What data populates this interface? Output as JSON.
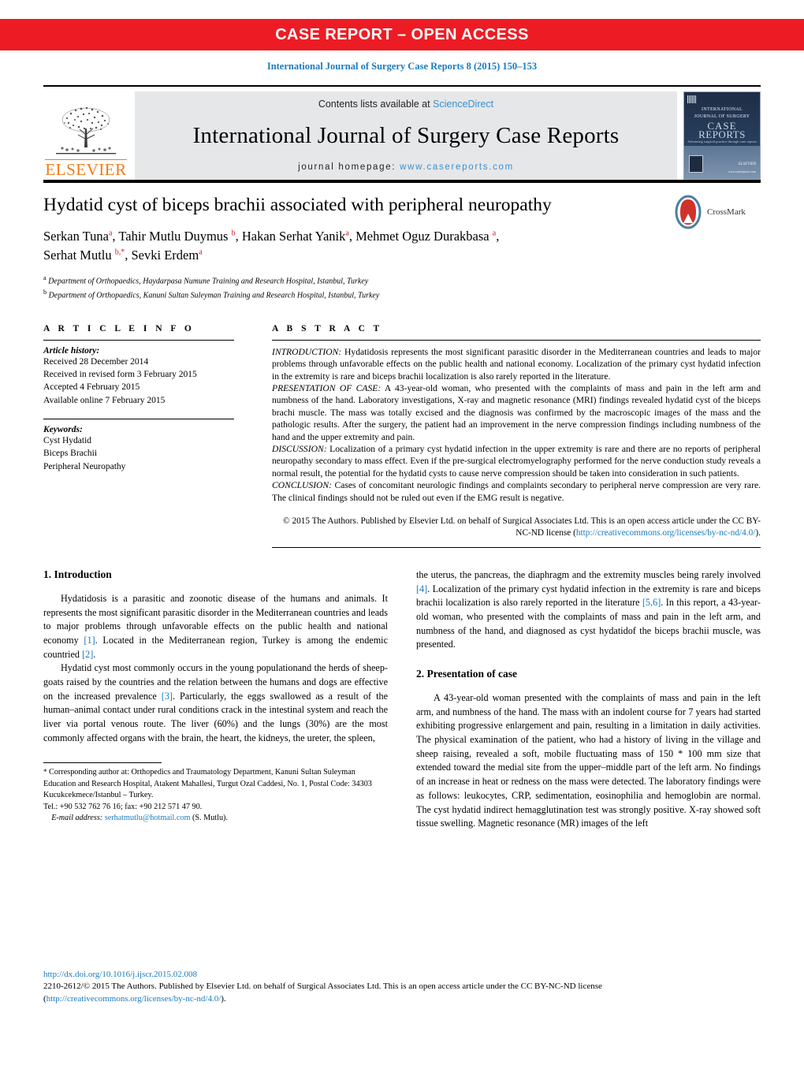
{
  "banner": {
    "text": "CASE REPORT – OPEN ACCESS",
    "color": "#ed1c24"
  },
  "citation": "International Journal of Surgery Case Reports 8 (2015) 150–153",
  "masthead": {
    "contents_prefix": "Contents lists available at ",
    "sciencedirect": "ScienceDirect",
    "journal_title": "International Journal of Surgery Case Reports",
    "homepage_prefix": "journal homepage: ",
    "homepage_url": "www.casereports.com",
    "publisher": "ELSEVIER",
    "cover": {
      "line1": "INTERNATIONAL",
      "line2": "JOURNAL OF SURGERY",
      "line3": "CASE",
      "line4": "REPORTS",
      "tagline": "Advancing surgical practice through case reports",
      "brand": "ELSEVIER",
      "url": "www.casereports.com"
    }
  },
  "article": {
    "title": "Hydatid cyst of biceps brachii associated with peripheral neuropathy",
    "crossmark_label": "CrossMark",
    "authors_line1": "Serkan Tuna",
    "authors_line1_sup_a": "a",
    "authors": "Serkan Tuna a, Tahir Mutlu Duymus b, Hakan Serhat Yanik a, Mehmet Oguz Durakbasa a, Serhat Mutlu b,*, Sevki Erdem a",
    "affiliation_a": "Department of Orthopaedics, Haydarpasa Numune Training and Research Hospital, Istanbul, Turkey",
    "affiliation_b": "Department of Orthopaedics, Kanuni Sultan Suleyman Training and Research Hospital, Istanbul, Turkey"
  },
  "info": {
    "heading": "A R T I C L E  I N F O",
    "history_label": "Article history:",
    "history": [
      "Received 28 December 2014",
      "Received in revised form 3 February 2015",
      "Accepted 4 February 2015",
      "Available online 7 February 2015"
    ],
    "keywords_label": "Keywords:",
    "keywords": [
      "Cyst Hydatid",
      "Biceps Brachii",
      "Peripheral Neuropathy"
    ]
  },
  "abstract": {
    "heading": "A B S T R A C T",
    "sections": [
      {
        "label": "INTRODUCTION:",
        "text": " Hydatidosis represents the most significant parasitic disorder in the Mediterranean countries and leads to major problems through unfavorable effects on the public health and national economy. Localization of the primary cyst hydatid infection in the extremity is rare and biceps brachii localization is also rarely reported in the literature."
      },
      {
        "label": "PRESENTATION OF CASE:",
        "text": " A 43-year-old woman, who presented with the complaints of mass and pain in the left arm and numbness of the hand. Laboratory investigations, X-ray and magnetic resonance (MRI) findings revealed hydatid cyst of the biceps brachi muscle. The mass was totally excised and the diagnosis was confirmed by the macroscopic images of the mass and the pathologic results. After the surgery, the patient had an improvement in the nerve compression findings including numbness of the hand and the upper extremity and pain."
      },
      {
        "label": "DISCUSSION:",
        "text": " Localization of a primary cyst hydatid infection in the upper extremity is rare and there are no reports of peripheral neuropathy secondary to mass effect. Even if the pre-surgical electromyelography performed for the nerve conduction study reveals a normal result, the potential for the hydatid cysts to cause nerve compression should be taken into consideration in such patients."
      },
      {
        "label": "CONCLUSION:",
        "text": " Cases of concomitant neurologic findings and complaints secondary to peripheral nerve compression are very rare. The clinical findings should not be ruled out even if the EMG result is negative."
      }
    ],
    "license_text_1": "© 2015 The Authors. Published by Elsevier Ltd. on behalf of Surgical Associates Ltd. This is an open access article under the CC BY-NC-ND license (",
    "license_url": "http://creativecommons.org/licenses/by-nc-nd/4.0/",
    "license_text_2": ")."
  },
  "body": {
    "left": {
      "section_heading": "1.  Introduction",
      "paragraph_1_a": "Hydatidosis is a parasitic and zoonotic disease of the humans and animals. It represents the most significant parasitic disorder in the Mediterranean countries and leads to major problems through unfavorable effects on the public health and national economy ",
      "paragraph_1_ref1": "[1]",
      "paragraph_1_b": ". Located in the Mediterranean region, Turkey is among the endemic countried ",
      "paragraph_1_ref2": "[2]",
      "paragraph_1_c": ".",
      "paragraph_2_a": "Hydatid cyst most commonly occurs in the young populationand the herds of sheep-goats raised by the countries and the relation between the humans and dogs are effective on the increased prevalence ",
      "paragraph_2_ref": "[3]",
      "paragraph_2_b": ". Particularly, the eggs swallowed as a result of the human–animal contact under rural conditions crack in the intestinal system and reach the liver via portal venous route. The liver (60%) and the lungs (30%) are the most commonly affected organs with the brain, the heart, the kidneys, the ureter, the spleen,"
    },
    "right": {
      "paragraph_1_a": "the uterus, the pancreas, the diaphragm and the extremity muscles being rarely involved ",
      "paragraph_1_ref1": "[4]",
      "paragraph_1_b": ". Localization of the primary cyst hydatid infection in the extremity is rare and biceps brachii localization is also rarely reported in the literature ",
      "paragraph_1_ref2": "[5,6]",
      "paragraph_1_c": ". In this report, a 43-year-old woman, who presented with the complaints of mass and pain in the left arm, and numbness of the hand, and diagnosed as cyst hydatidof the biceps brachii muscle, was presented.",
      "section_heading": "2.  Presentation of case",
      "paragraph_2": "A 43-year-old woman presented with the complaints of mass and pain in the left arm, and numbness of the hand. The mass with an indolent course for 7 years had started exhibiting progressive enlargement and pain, resulting in a limitation in daily activities. The physical examination of the patient, who had a history of living in the village and sheep raising, revealed a soft, mobile fluctuating mass of 150 * 100 mm size that extended toward the medial site from the upper–middle part of the left arm. No findings of an increase in heat or redness on the mass were detected. The laboratory findings were as follows: leukocytes, CRP, sedimentation, eosinophilia and hemoglobin are normal. The cyst hydatid indirect hemagglutination test was strongly positive. X-ray showed soft tissue swelling. Magnetic resonance (MR) images of the left"
    }
  },
  "footnote": {
    "star": "*",
    "text": " Corresponding author at: Orthopedics and Traumatology Department, Kanuni Sultan Suleyman Education and Research Hospital, Atakent Mahallesi, Turgut Ozal Caddesi, No. 1, Postal Code: 34303 Kucukcekmece/Istanbul – Turkey.",
    "tel": "Tel.: +90 532 762 76 16; fax: +90 212 571 47 90.",
    "email_label": "E-mail address:",
    "email": "serhatmutlu@hotmail.com",
    "email_suffix": " (S. Mutlu)."
  },
  "page_footer": {
    "doi": "http://dx.doi.org/10.1016/j.ijscr.2015.02.008",
    "issn_line": "2210-2612/© 2015 The Authors. Published by Elsevier Ltd. on behalf of Surgical Associates Ltd. This is an open access article under the CC BY-NC-ND license",
    "license_open": "(",
    "license_url": "http://creativecommons.org/licenses/by-nc-nd/4.0/",
    "license_close": ")."
  }
}
